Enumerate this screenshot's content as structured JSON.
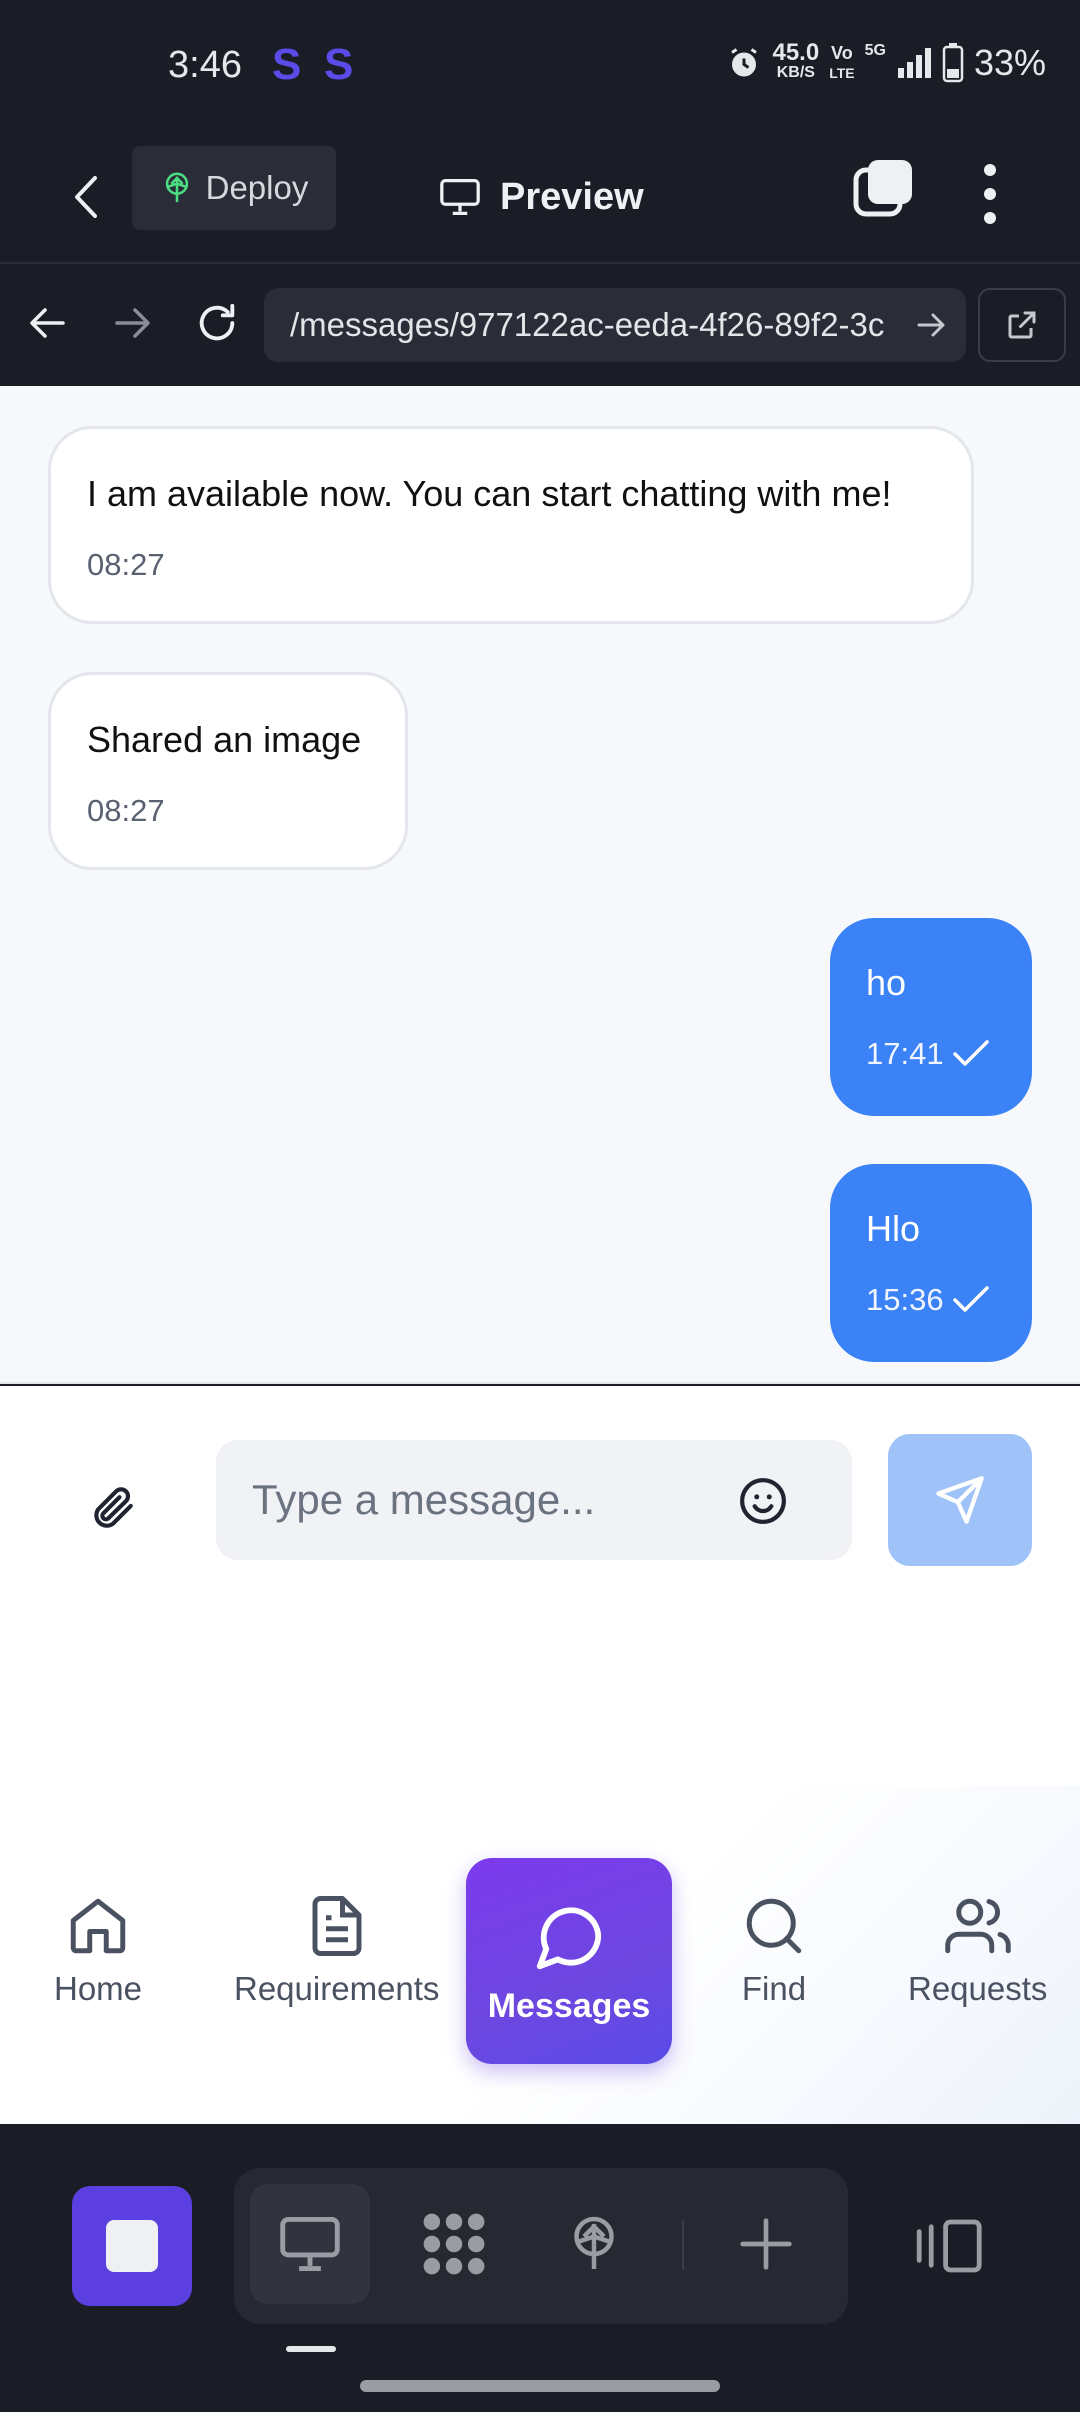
{
  "status_bar": {
    "time": "3:46",
    "app_badges": [
      "S",
      "S"
    ],
    "net_speed_top": "45.0",
    "net_speed_bottom": "KB/S",
    "volte_top": "Vo",
    "volte_bottom": "LTE",
    "network": "5G",
    "battery": "33%"
  },
  "app_bar": {
    "deploy_label": "Deploy",
    "preview_label": "Preview"
  },
  "browser": {
    "url": "/messages/977122ac-eeda-4f26-89f2-3c"
  },
  "messages": [
    {
      "direction": "incoming",
      "text": "I am available now. You can start chatting with me!",
      "time": "08:27"
    },
    {
      "direction": "incoming",
      "text": "Shared an image",
      "time": "08:27"
    },
    {
      "direction": "outgoing",
      "text": "ho",
      "time": "17:41",
      "status": "sent"
    },
    {
      "direction": "outgoing",
      "text": "Hlo",
      "time": "15:36",
      "status": "sent"
    }
  ],
  "composer": {
    "placeholder": "Type a message...",
    "value": ""
  },
  "tabs": [
    {
      "label": "Home",
      "icon": "home-icon",
      "active": false
    },
    {
      "label": "Requirements",
      "icon": "document-icon",
      "active": false
    },
    {
      "label": "Messages",
      "icon": "chat-bubble-icon",
      "active": true
    },
    {
      "label": "Find",
      "icon": "search-icon",
      "active": false
    },
    {
      "label": "Requests",
      "icon": "users-icon",
      "active": false
    }
  ],
  "colors": {
    "accent": "#6d47e0",
    "outgoing_bubble": "#3b82f6",
    "send_button": "#9fc2f9",
    "dark_chrome": "#1b1d26"
  }
}
